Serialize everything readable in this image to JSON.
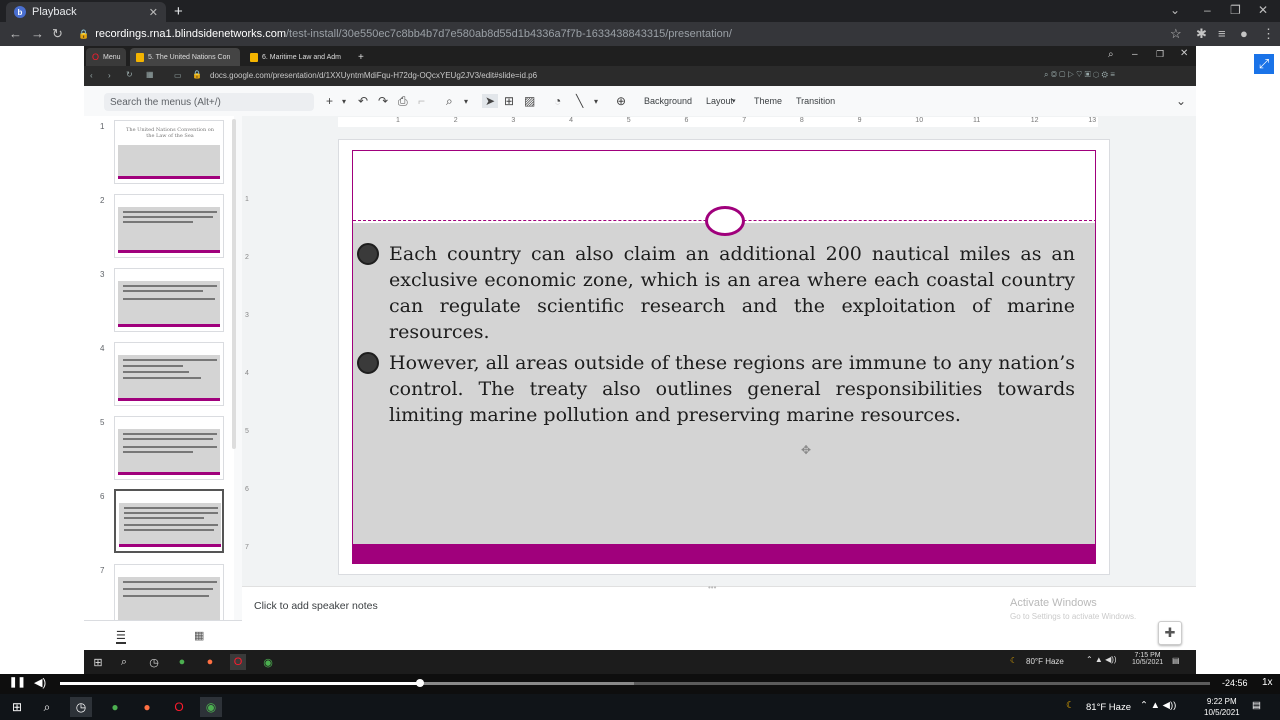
{
  "outer_browser": {
    "tab_title": "Playback",
    "url_host": "recordings.rna1.blindsidenetworks.com",
    "url_path": "/test-install/30e550ec7c8bb4b7d7e580ab8d55d1b4336a7f7b-1633438843315/presentation/"
  },
  "inner_browser": {
    "menu_label": "Menu",
    "tab1": "5. The United Nations Con",
    "tab2": "6. Maritime Law and Adm",
    "address": "docs.google.com/presentation/d/1XXUyntmMdiFqu-H72dg-OQcxYEUg2JV3/edit#slide=id.p6"
  },
  "slides_ui": {
    "search_placeholder": "Search the menus (Alt+/)",
    "toolbar": {
      "background": "Background",
      "layout": "Layout",
      "theme": "Theme",
      "transition": "Transition"
    },
    "thumb_numbers": [
      "1",
      "2",
      "3",
      "4",
      "5",
      "6",
      "7"
    ],
    "selected_slide": 6,
    "thumb1_title": "The United Nations Convention on the Law of the Sea",
    "ruler_ticks": [
      "1",
      "2",
      "3",
      "4",
      "5",
      "6",
      "7",
      "8",
      "9",
      "10",
      "11",
      "12",
      "13"
    ],
    "ruler_v_ticks": [
      "1",
      "2",
      "3",
      "4",
      "5",
      "6",
      "7"
    ],
    "speaker_notes_placeholder": "Click to add speaker notes",
    "activate_title": "Activate Windows",
    "activate_sub": "Go to Settings to activate Windows."
  },
  "slide": {
    "para1": "Each country can also claim an additional 200 nautical miles as an exclusive economic zone, which is an area where each coastal country can regulate scientific research and the exploitation of marine resources.",
    "para2": "However, all areas outside of these regions are immune to any nation’s control. The treaty also outlines general responsibilities towards limiting marine pollution and preserving marine resources."
  },
  "inner_taskbar": {
    "weather": "80°F Haze",
    "time": "7:15 PM",
    "date": "10/5/2021"
  },
  "player": {
    "time_remaining": "-24:56",
    "speed": "1x",
    "progress_fraction": 0.313
  },
  "os_taskbar": {
    "weather": "81°F Haze",
    "time": "9:22 PM",
    "date": "10/5/2021"
  },
  "colors": {
    "accent_magenta": "#a0007c",
    "slide_gray": "#d4d4d4"
  }
}
